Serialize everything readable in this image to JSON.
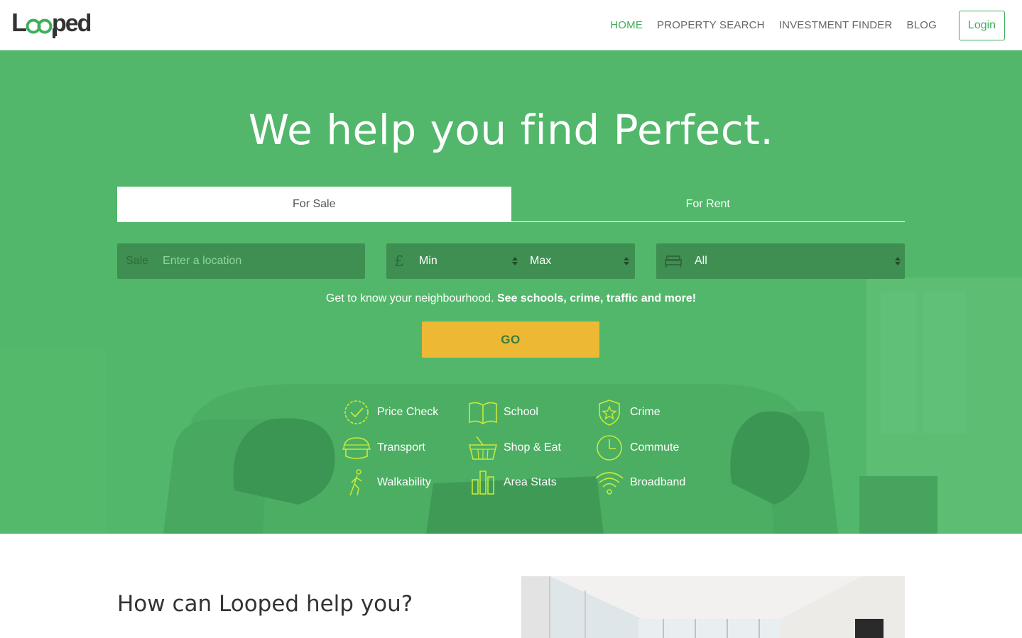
{
  "header": {
    "logo_text": "Looped",
    "nav": [
      {
        "label": "HOME",
        "active": true
      },
      {
        "label": "PROPERTY SEARCH",
        "active": false
      },
      {
        "label": "INVESTMENT FINDER",
        "active": false
      },
      {
        "label": "BLOG",
        "active": false
      }
    ],
    "login_label": "Login"
  },
  "hero": {
    "title": "We help you find Perfect.",
    "tabs": [
      {
        "label": "For Sale",
        "active": true
      },
      {
        "label": "For Rent",
        "active": false
      }
    ],
    "search": {
      "location_prefix": "Sale",
      "location_placeholder": "Enter a location",
      "currency_symbol": "£",
      "min_price": "Min",
      "max_price": "Max",
      "bedrooms": "All"
    },
    "neighbourhood_text": "Get to know your neighbourhood.",
    "neighbourhood_bold": "See schools, crime, traffic and more!",
    "go_label": "GO",
    "features": [
      {
        "label": "Price Check",
        "icon": "price-check-icon"
      },
      {
        "label": "School",
        "icon": "school-icon"
      },
      {
        "label": "Crime",
        "icon": "crime-icon"
      },
      {
        "label": "Transport",
        "icon": "transport-icon"
      },
      {
        "label": "Shop & Eat",
        "icon": "shop-eat-icon"
      },
      {
        "label": "Commute",
        "icon": "commute-icon"
      },
      {
        "label": "Walkability",
        "icon": "walkability-icon"
      },
      {
        "label": "Area Stats",
        "icon": "area-stats-icon"
      },
      {
        "label": "Broadband",
        "icon": "broadband-icon"
      }
    ]
  },
  "section": {
    "title": "How can Looped help you?"
  },
  "colors": {
    "brand_green": "#3fae5a",
    "hero_green": "#52b76a",
    "field_green": "#3f8f52",
    "icon_lime": "#c6ea3a",
    "go_yellow": "#edb935"
  }
}
